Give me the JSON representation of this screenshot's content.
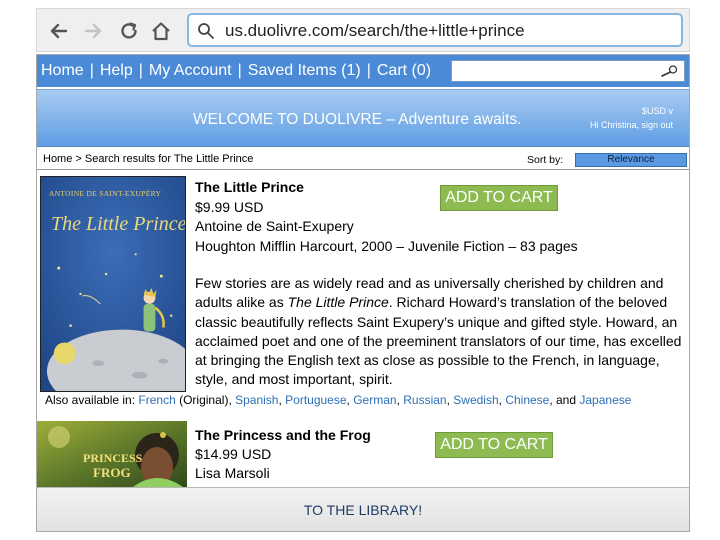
{
  "browser": {
    "url": "us.duolivre.com/search/the+little+prince"
  },
  "nav": {
    "items": [
      {
        "label": "Home"
      },
      {
        "label": "Help"
      },
      {
        "label": "My Account"
      },
      {
        "label": "Saved Items (1)"
      },
      {
        "label": "Cart (0)"
      }
    ],
    "separator": "|"
  },
  "banner": {
    "welcome": "WELCOME TO DUOLIVRE – Adventure awaits.",
    "currency": "$USD v",
    "greeting": "Hi Christina, sign out"
  },
  "breadcrumb": "Home > Search results for The Little Prince",
  "sort": {
    "label": "Sort by:",
    "selected": "Relevance"
  },
  "results": [
    {
      "title": "The Little Prince",
      "price": "$9.99 USD",
      "author": "Antoine de Saint-Exupery",
      "details": "Houghton Mifflin Harcourt, 2000 – Juvenile Fiction – 83 pages",
      "add_label": "ADD TO CART",
      "cover": {
        "author_line": "ANTOINE DE SAINT-EXUPÉRY",
        "title_line": "The Little Prince"
      },
      "description": {
        "before": "Few stories are as widely read and as universally cherished by children and adults alike as ",
        "italic": "The Little Prince",
        "after": ". Richard Howard’s translation of the beloved classic beautifully reflects Saint Exupery’s unique and gifted style. Howard, an acclaimed poet and one of the preeminent translators of our time, has excelled at bringing the English text as close as possible to the French, in language, style, and most important, spirit."
      },
      "also_available": {
        "label": "Also available in:",
        "languages": [
          {
            "name": "French",
            "suffix": " (Original), "
          },
          {
            "name": "Spanish",
            "suffix": ", "
          },
          {
            "name": "Portuguese",
            "suffix": ", "
          },
          {
            "name": "German",
            "suffix": ", "
          },
          {
            "name": "Russian",
            "suffix": ", "
          },
          {
            "name": "Swedish",
            "suffix": ", "
          },
          {
            "name": "Chinese",
            "suffix": ", and "
          },
          {
            "name": "Japanese",
            "suffix": ""
          }
        ]
      }
    },
    {
      "title": "The Princess and the Frog",
      "price": "$14.99 USD",
      "author": "Lisa Marsoli",
      "add_label": "ADD TO CART",
      "cover": {
        "title_top": "PRINCESS",
        "title_bottom": "FROG"
      }
    }
  ],
  "footer": {
    "label": "TO THE LIBRARY!"
  },
  "colors": {
    "nav_bar": "#4a8ad6",
    "add_to_cart": "#8dbb52",
    "link": "#2e6fb6",
    "url_border": "#86b6e6"
  }
}
